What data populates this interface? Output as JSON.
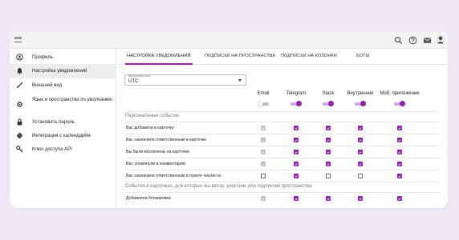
{
  "topbar": {
    "menu_icon": "hamburger-icon",
    "icons": [
      "search-icon",
      "help-icon",
      "mail-icon",
      "avatar"
    ]
  },
  "sidebar": {
    "items": [
      {
        "label": "Профиль",
        "icon": "profile-icon",
        "active": false
      },
      {
        "label": "Настройка уведомлений",
        "icon": "bell-icon",
        "active": true
      },
      {
        "label": "Внешний вид",
        "icon": "brush-icon",
        "active": false
      },
      {
        "label": "Язык и пространство по умолчанию",
        "icon": "gear-icon",
        "active": false
      },
      {
        "label": "Установить пароль",
        "icon": "lock-icon",
        "active": false
      },
      {
        "label": "Интеграция с календарём",
        "icon": "calendar-icon",
        "active": false
      },
      {
        "label": "Ключ доступа API",
        "icon": "key-icon",
        "active": false
      }
    ]
  },
  "tabs": [
    {
      "label": "Настройка уведомлений",
      "active": true
    },
    {
      "label": "Подписки на пространства",
      "active": false
    },
    {
      "label": "Подписки на колонки",
      "active": false
    },
    {
      "label": "Боты",
      "active": false
    }
  ],
  "timezone": {
    "label": "Временная зона",
    "value": "UTC"
  },
  "channels": [
    {
      "name": "Email",
      "enabled": false
    },
    {
      "name": "Telegram",
      "enabled": true
    },
    {
      "name": "Slack",
      "enabled": true
    },
    {
      "name": "Внутренние",
      "enabled": true
    },
    {
      "name": "Моб. приложение",
      "enabled": true
    }
  ],
  "sections": [
    {
      "title": "Персональные события",
      "rows": [
        {
          "label": "Вас добавили в карточку",
          "values": [
            "disabled",
            "on",
            "on",
            "on",
            "on"
          ]
        },
        {
          "label": "Вас назначили ответственным в карточке",
          "values": [
            "disabled",
            "on",
            "on",
            "on",
            "on"
          ]
        },
        {
          "label": "Вы были исключены из карточки",
          "values": [
            "disabled",
            "on",
            "on",
            "on",
            "on"
          ]
        },
        {
          "label": "Вас упомянули в комментарии",
          "values": [
            "disabled",
            "on",
            "on",
            "on",
            "on"
          ]
        },
        {
          "label": "Вас назначили ответственным в пункте чеклиста",
          "values": [
            "off",
            "on",
            "off",
            "off",
            "on"
          ]
        }
      ]
    },
    {
      "title": "События в карточках, для которых вы автор, участник или подписчик пространства",
      "rows": [
        {
          "label": "Добавлена блокировка",
          "values": [
            "disabled",
            "on",
            "on",
            "on",
            "on"
          ]
        }
      ]
    }
  ],
  "colors": {
    "accent": "#8e24aa",
    "accent_light": "#d9a3e8",
    "background": "#efe9f7"
  }
}
